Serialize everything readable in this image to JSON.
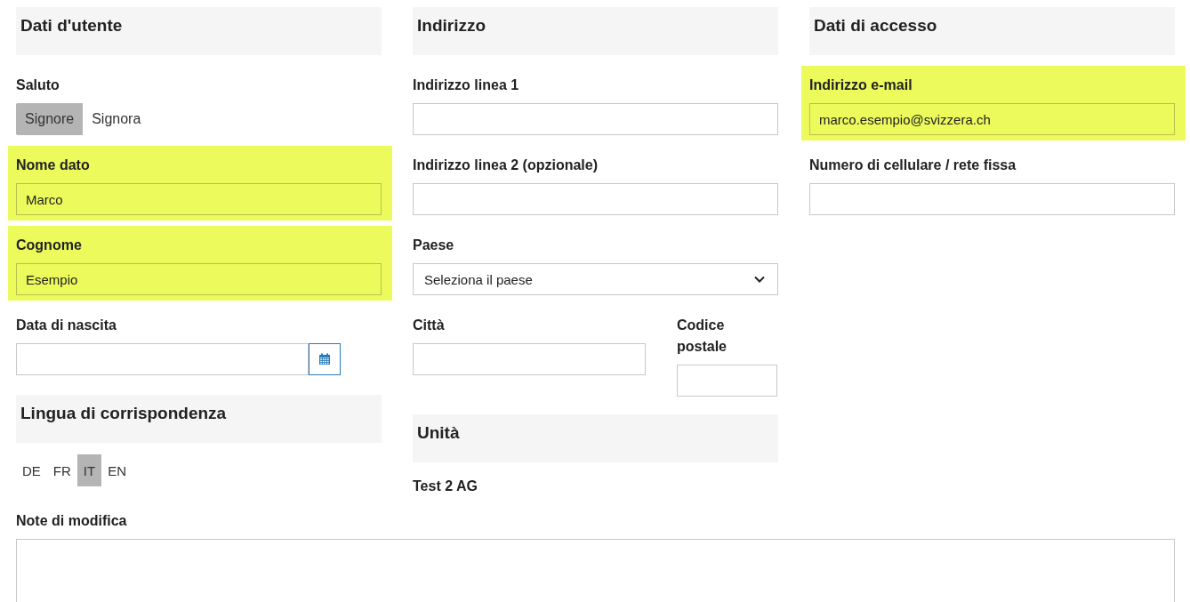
{
  "columns": [
    {
      "sections": [
        {
          "heading": "Dati d'utente",
          "items": [
            {
              "kind": "toggle",
              "label": "Saluto",
              "options": [
                {
                  "label": "Signore",
                  "selected": true
                },
                {
                  "label": "Signora",
                  "selected": false
                }
              ]
            },
            {
              "kind": "text",
              "label": "Nome dato",
              "value": "Marco",
              "highlighted": true
            },
            {
              "kind": "text",
              "label": "Cognome",
              "value": "Esempio",
              "highlighted": true
            },
            {
              "kind": "date",
              "label": "Data di nascita",
              "highlighted": false
            }
          ]
        },
        {
          "heading": "Lingua di corrispondenza",
          "items": [
            {
              "kind": "langs",
              "options": [
                {
                  "label": "DE",
                  "selected": false
                },
                {
                  "label": "FR",
                  "selected": false
                },
                {
                  "label": "IT",
                  "selected": true
                },
                {
                  "label": "EN",
                  "selected": false
                }
              ]
            }
          ]
        }
      ]
    },
    {
      "sections": [
        {
          "heading": "Indirizzo",
          "items": [
            {
              "kind": "text",
              "label": "Indirizzo linea 1",
              "highlighted": false
            },
            {
              "kind": "text",
              "label": "Indirizzo linea 2 (opzionale)",
              "highlighted": false
            },
            {
              "kind": "select",
              "label": "Paese",
              "value": "Seleziona il paese",
              "highlighted": false
            },
            {
              "kind": "pair",
              "fields": [
                {
                  "label": "Città"
                },
                {
                  "label": "Codice postale"
                }
              ]
            }
          ]
        },
        {
          "heading": "Unità",
          "items": [
            {
              "kind": "plain",
              "value": "Test 2 AG"
            }
          ]
        }
      ]
    },
    {
      "sections": [
        {
          "heading": "Dati di accesso",
          "items": [
            {
              "kind": "text",
              "label": "Indirizzo e-mail",
              "value": "marco.esempio@svizzera.ch",
              "highlighted": true
            },
            {
              "kind": "text",
              "label": "Numero di cellulare / rete fissa",
              "highlighted": false
            }
          ]
        }
      ]
    }
  ],
  "notes": {
    "label": "Note di modifica"
  }
}
